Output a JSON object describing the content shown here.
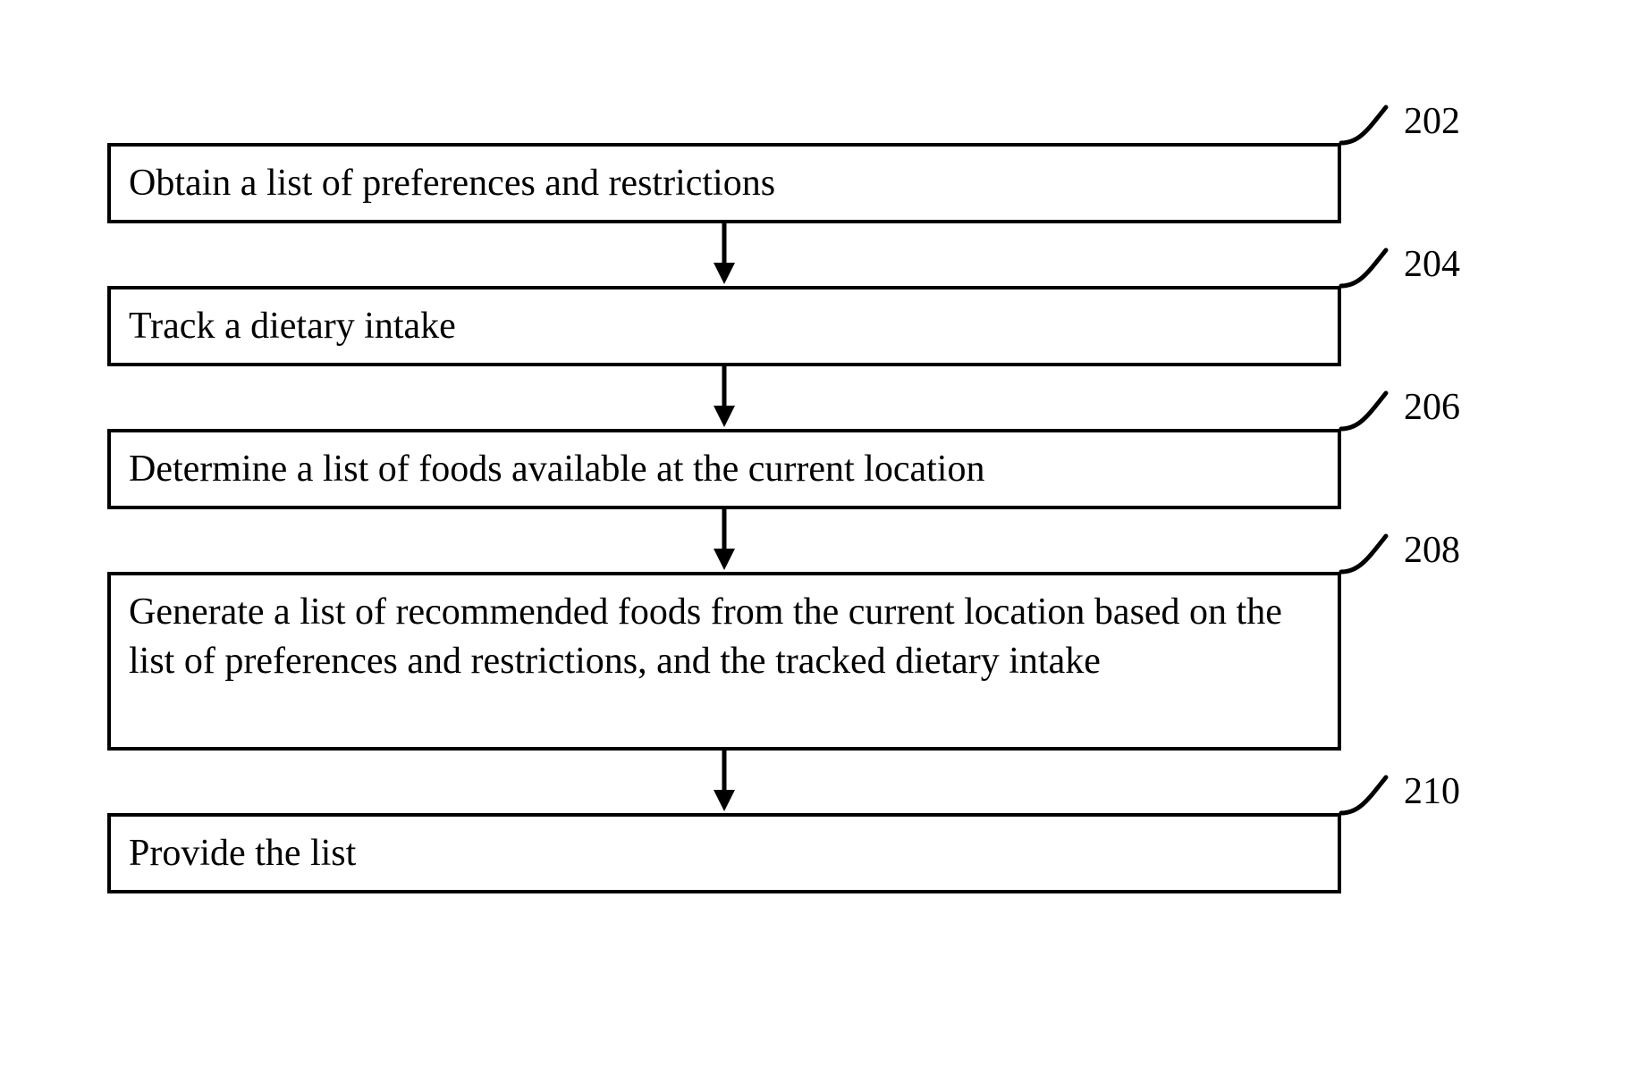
{
  "steps": [
    {
      "ref": "202",
      "text": "Obtain a list of preferences and restrictions"
    },
    {
      "ref": "204",
      "text": "Track a dietary intake"
    },
    {
      "ref": "206",
      "text": "Determine a list of foods available at the current location"
    },
    {
      "ref": "208",
      "text": "Generate a list of recommended foods from the current location based on the list of preferences and restrictions, and the tracked dietary intake"
    },
    {
      "ref": "210",
      "text": "Provide the list"
    }
  ]
}
